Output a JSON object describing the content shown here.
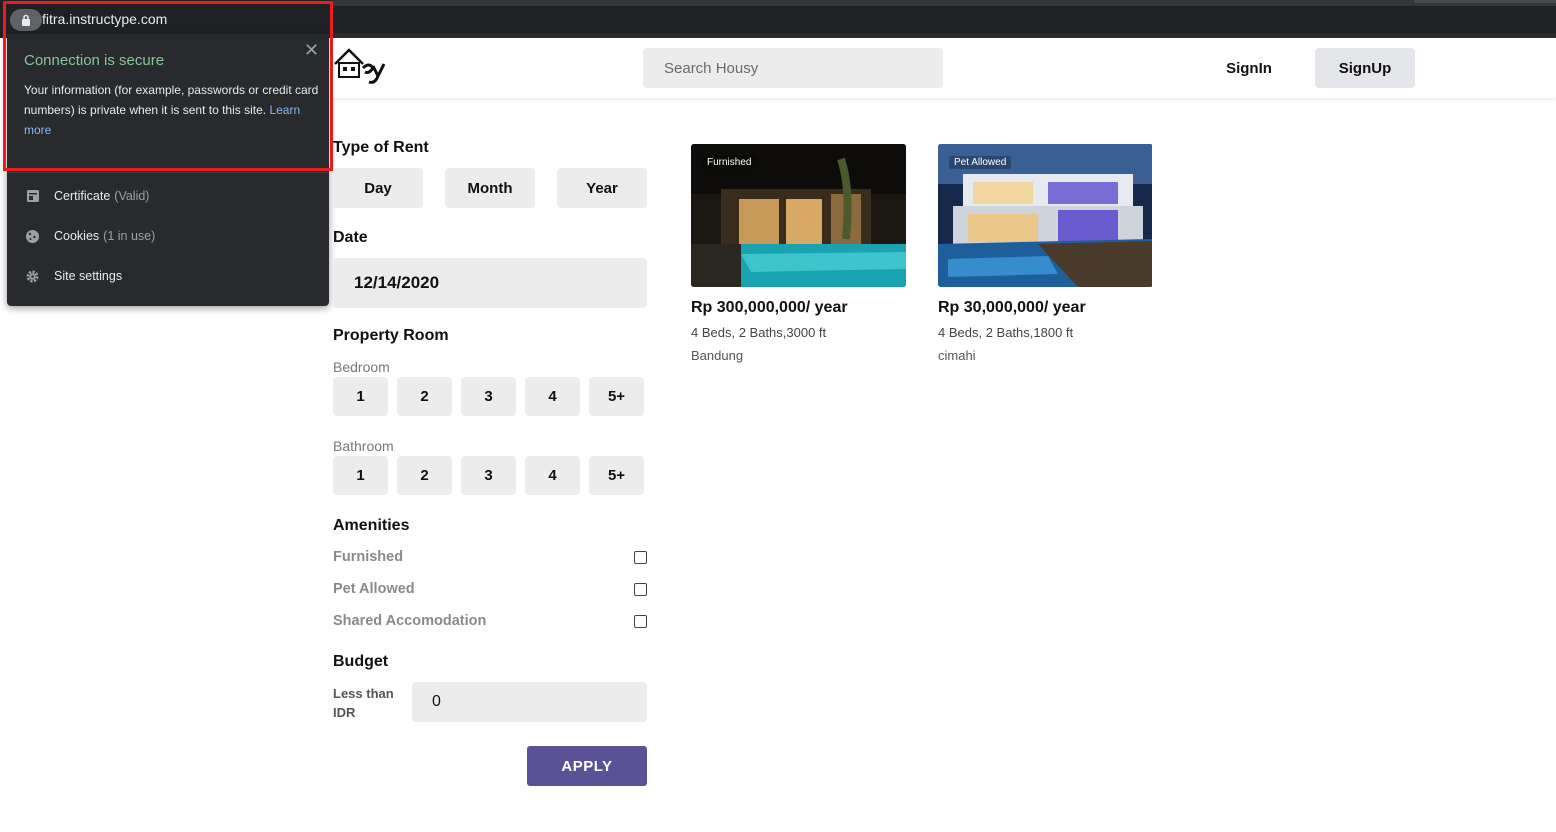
{
  "browser": {
    "url": "fitra.instructype.com",
    "popup": {
      "title": "Connection is secure",
      "body": "Your information (for example, passwords or credit card numbers) is private when it is sent to this site.",
      "learn_more": "Learn more",
      "rows": [
        {
          "label": "Certificate",
          "status": "(Valid)",
          "icon": "certificate-icon"
        },
        {
          "label": "Cookies",
          "status": "(1 in use)",
          "icon": "cookie-icon"
        },
        {
          "label": "Site settings",
          "status": "",
          "icon": "gear-icon"
        }
      ]
    }
  },
  "header": {
    "search_placeholder": "Search Housy",
    "signin": "SignIn",
    "signup": "SignUp"
  },
  "filters": {
    "type_of_rent": {
      "heading": "Type of Rent",
      "options": [
        "Day",
        "Month",
        "Year"
      ]
    },
    "date": {
      "heading": "Date",
      "value": "12/14/2020"
    },
    "property_room": {
      "heading": "Property Room",
      "bedroom_label": "Bedroom",
      "bedroom_options": [
        "1",
        "2",
        "3",
        "4",
        "5+"
      ],
      "bathroom_label": "Bathroom",
      "bathroom_options": [
        "1",
        "2",
        "3",
        "4",
        "5+"
      ]
    },
    "amenities": {
      "heading": "Amenities",
      "items": [
        "Furnished",
        "Pet Allowed",
        "Shared Accomodation"
      ]
    },
    "budget": {
      "heading": "Budget",
      "label": "Less than IDR",
      "value": "0"
    },
    "apply": "APPLY"
  },
  "listings": [
    {
      "tag": "Furnished",
      "price": "Rp 300,000,000/ year",
      "spec": "4 Beds, 2 Baths,3000 ft",
      "city": "Bandung"
    },
    {
      "tag": "Pet Allowed",
      "price": "Rp 30,000,000/ year",
      "spec": "4 Beds, 2 Baths,1800 ft",
      "city": "cimahi"
    }
  ]
}
